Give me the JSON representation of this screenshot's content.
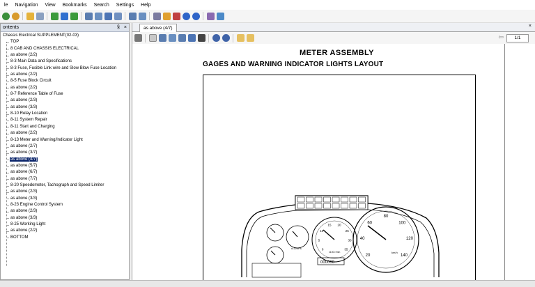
{
  "menu": [
    "le",
    "Navigation",
    "View",
    "Bookmarks",
    "Search",
    "Settings",
    "Help"
  ],
  "toolbar_icons": [
    "back-icon",
    "refresh-icon",
    "open-folder-icon",
    "export-icon",
    "arrow-left-icon",
    "arrow-right-icon",
    "home-icon",
    "print-preview-icon",
    "panel-icon",
    "document-icon",
    "window-icon",
    "layout-icon",
    "print-icon",
    "highlight-icon",
    "tools-icon",
    "info-icon",
    "help-icon",
    "note-icon",
    "pen-icon"
  ],
  "contents_panel": {
    "title": "ontents",
    "pin": "§",
    "close": "×",
    "root": "Chassis Electrical SUPPLEMENT(02-03)",
    "items": [
      "TOP",
      "8 CAB AND CHASSIS ELECTRICAL",
      "as above (2/2)",
      "8-3 Main Data and Specifications",
      "8-3 Fuse, Fusible Link wire and Slow Blow Fuse Location",
      "as above (2/2)",
      "8-5 Fuse Block Circuit",
      "as above (2/2)",
      "8-7 Reference Table of Fuse",
      "as above (2/3)",
      "as above (3/3)",
      "8-10 Relay Location",
      "8-11 System Repair",
      "8-11 Start and Charging",
      "as above (2/2)",
      "8-13 Meter and Warning/Indicator Light",
      "as above (2/7)",
      "as above (3/7)",
      "as above (4/7)",
      "as above (5/7)",
      "as above (6/7)",
      "as above (7/7)",
      "8-20 Speedometer, Tachograph and Speed Limiter",
      "as above (2/3)",
      "as above (3/3)",
      "8-23 Engine Control System",
      "as above (2/3)",
      "as above (3/3)",
      "8-25 Working Light",
      "as above (2/2)",
      "BOTTOM"
    ],
    "selected_index": 18
  },
  "document": {
    "tab": "as above (4/7)",
    "tab_close": "×",
    "page": "1/1",
    "prev": "⇦",
    "heading1": "METER ASSEMBLY",
    "heading2": "GAGES AND WARNING INDICATOR LIGHTS LAYOUT",
    "speedo_ticks": [
      "20",
      "40",
      "60",
      "80",
      "100",
      "120",
      "140"
    ],
    "speedo_unit": "km/h",
    "tacho_ticks": [
      "0",
      "5",
      "10",
      "15",
      "20",
      "25",
      "30",
      "35"
    ],
    "tacho_unit": "x100 r/min",
    "odometer": "000000",
    "gauge_unit": "x100 kPa"
  },
  "colors": {
    "selection": "#0a246a",
    "panel_header": "#dde3ec"
  }
}
